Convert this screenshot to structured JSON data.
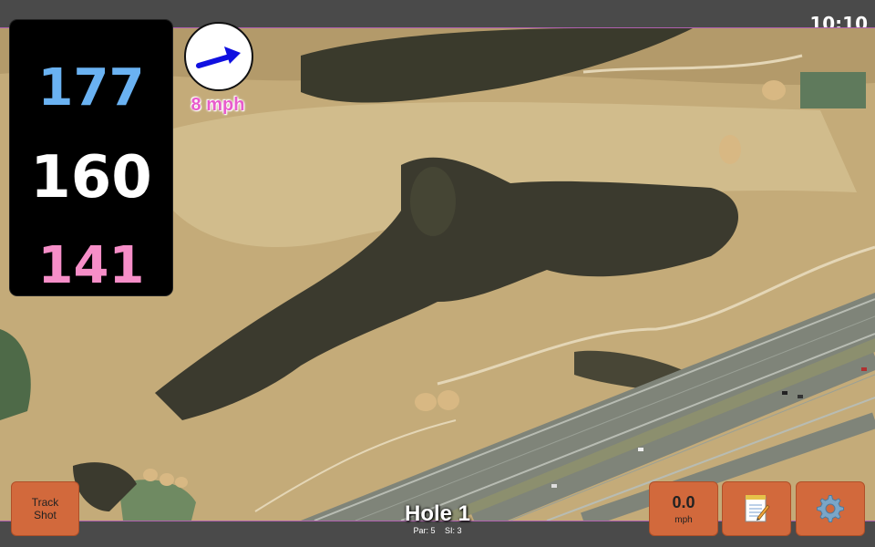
{
  "status": {
    "time": "10:10"
  },
  "distances": {
    "back": "177",
    "middle": "160",
    "front": "141"
  },
  "wind": {
    "speed": "8 mph",
    "icon": "wind-direction-arrow-icon"
  },
  "hole": {
    "title": "Hole 1",
    "par": "Par: 5",
    "si": "SI: 3"
  },
  "buttons": {
    "track_shot": "Track Shot",
    "speed_value": "0.0",
    "speed_unit": "mph",
    "notes_icon": "notepad-icon",
    "settings_icon": "gear-icon"
  },
  "colors": {
    "back": "#6ab2f2",
    "middle": "#ffffff",
    "front": "#f68ec8",
    "wind_text": "#e85ccc",
    "button": "#d2693c"
  }
}
